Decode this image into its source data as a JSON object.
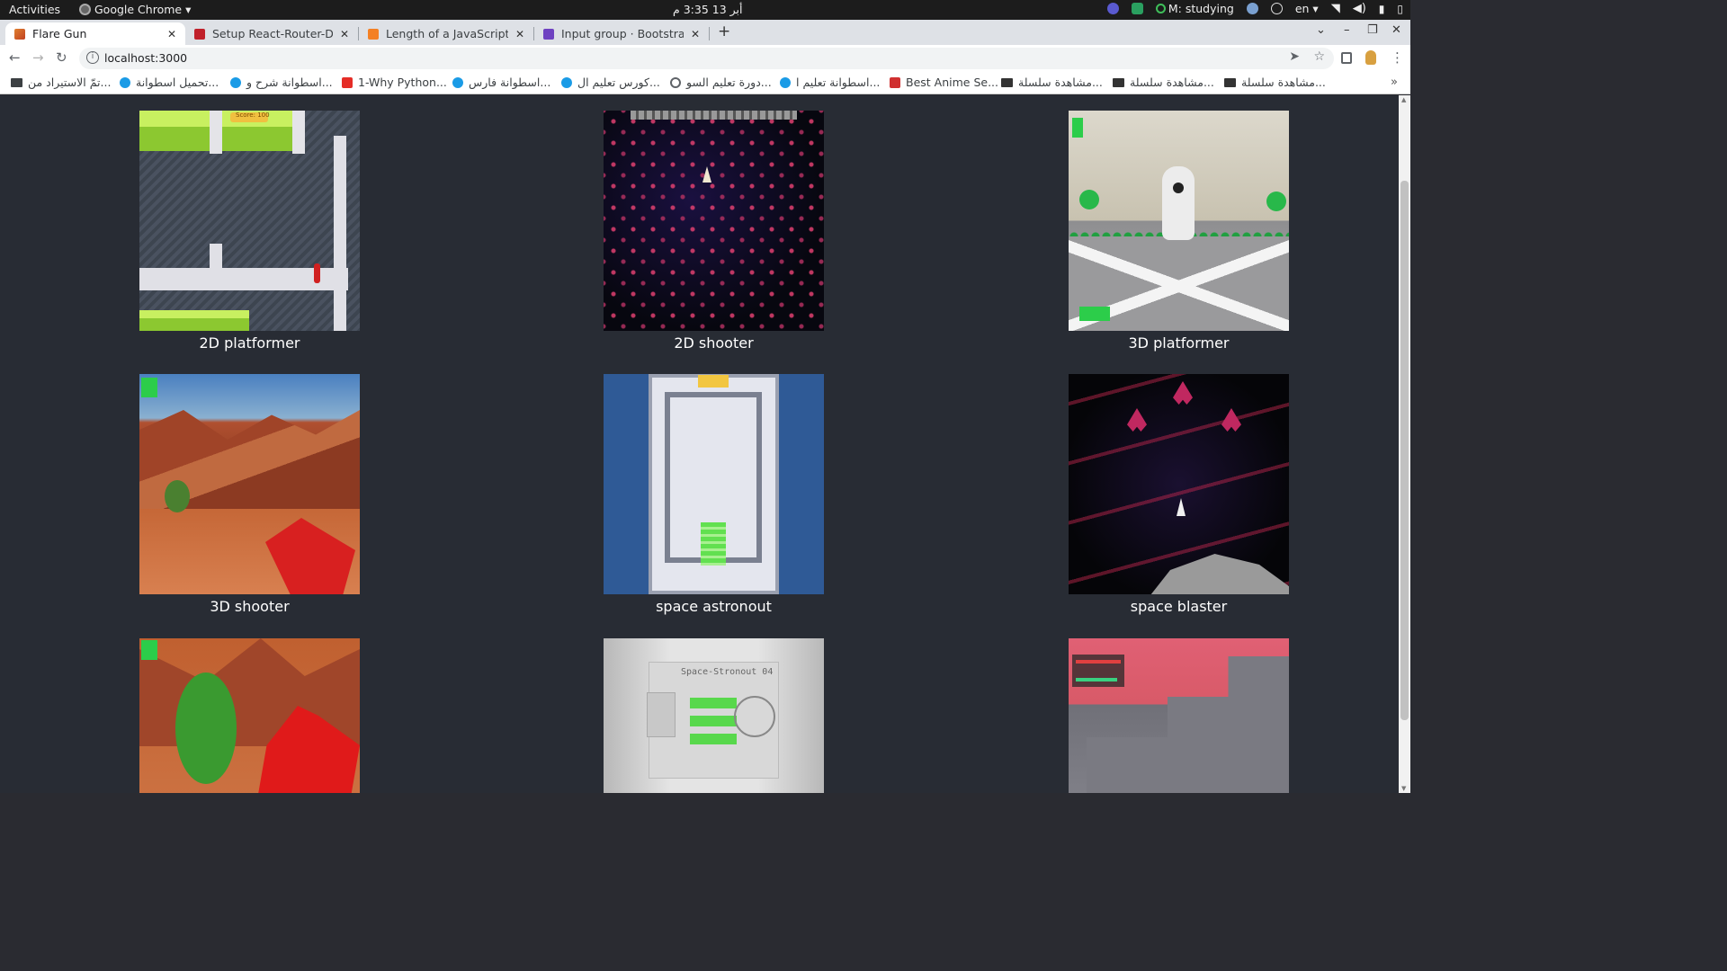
{
  "topbar": {
    "activities": "Activities",
    "app_name": "Google Chrome",
    "app_arrow": "▾",
    "clock": "أبر 13  3:35 م",
    "status": "M: studying",
    "language": "en",
    "language_arrow": "▾"
  },
  "tabs": [
    {
      "title": "Flare Gun",
      "active": true
    },
    {
      "title": "Setup React-Router-Dom",
      "active": false
    },
    {
      "title": "Length of a JavaScript ob",
      "active": false
    },
    {
      "title": "Input group · Bootstrap",
      "active": false
    }
  ],
  "tab_close": "✕",
  "new_tab": "+",
  "window_controls": {
    "dropdown": "⌄",
    "minimize": "–",
    "restore": "❐",
    "close": "✕"
  },
  "toolbar": {
    "back": "←",
    "forward": "→",
    "reload": "↻",
    "url": "localhost:3000",
    "info": "i",
    "send": "➤",
    "star": "☆",
    "menu": "⋮"
  },
  "bookmarks": [
    {
      "label": "تمّ الاستيراد من...",
      "icon": "folder-icon",
      "color": "#3c4043"
    },
    {
      "label": "تحميل اسطوانة...",
      "icon": "globe-icon",
      "color": "#1a9be6"
    },
    {
      "label": "اسطوانة شرح و...",
      "icon": "globe-icon",
      "color": "#1a9be6"
    },
    {
      "label": "1-Why Python...",
      "icon": "youtube-icon",
      "color": "#e52d27"
    },
    {
      "label": "اسطوانة فارس...",
      "icon": "globe-icon",
      "color": "#1a9be6"
    },
    {
      "label": "كورس تعليم ال...",
      "icon": "globe-icon",
      "color": "#1a9be6"
    },
    {
      "label": "دورة تعليم السو...",
      "icon": "globe-icon",
      "color": "#5f6368"
    },
    {
      "label": "اسطوانة تعليم ا...",
      "icon": "globe-icon",
      "color": "#1a9be6"
    },
    {
      "label": "Best Anime Se...",
      "icon": "anime-icon",
      "color": "#d03030"
    },
    {
      "label": "مشاهدة سلسلة...",
      "icon": "clapper-icon",
      "color": "#333"
    },
    {
      "label": "مشاهدة سلسلة...",
      "icon": "clapper-icon",
      "color": "#333"
    },
    {
      "label": "مشاهدة سلسلة...",
      "icon": "clapper-icon",
      "color": "#333"
    }
  ],
  "bookmarks_more": "»",
  "games": [
    {
      "title": "2D platformer"
    },
    {
      "title": "2D shooter"
    },
    {
      "title": "3D platformer"
    },
    {
      "title": "3D shooter"
    },
    {
      "title": "space astronout"
    },
    {
      "title": "space blaster"
    },
    {
      "title": ""
    },
    {
      "title": ""
    },
    {
      "title": ""
    }
  ],
  "thumb_text": {
    "t1_score": "Score: 100",
    "t8_title": "Space-Stronout 04"
  },
  "colors": {
    "page_background": "#282c34",
    "caption_text": "#ffffff",
    "topbar": "#1c1c1c",
    "tabstrip": "#dee1e6"
  }
}
